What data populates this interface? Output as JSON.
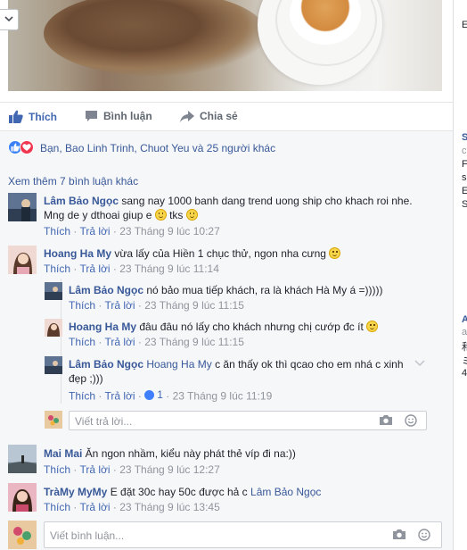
{
  "post": {
    "actions": {
      "like": "Thích",
      "comment": "Bình luận",
      "share": "Chia sẻ"
    },
    "reactions_text": "Bạn, Bao Linh Trinh, Chuot Yeu và 25 người khác",
    "more_comments": "Xem thêm 7 bình luận khác"
  },
  "labels": {
    "like": "Thích",
    "reply": "Trả lời"
  },
  "comments": [
    {
      "name": "Lâm Bảo Ngọc",
      "line1": " sang nay 1000 banh dang trend uong ship cho khach roi nhe.",
      "line2a": "Mng de y dthoai giup e ",
      "line2b": " tks ",
      "time": "23 Tháng 9 lúc 10:27"
    },
    {
      "name": "Hoang Ha My",
      "text": " vừa lấy của Hiền 1 chục thử, ngon nha cưng ",
      "time": "23 Tháng 9 lúc 11:14"
    },
    {
      "name": "Mai Mai",
      "text": " Ăn ngon nhầm, kiểu này phát thẻ víp đi na:))",
      "time": "23 Tháng 9 lúc 12:27"
    },
    {
      "name": "TràMy MyMy",
      "text": " E đặt 30c hay 50c được hả c ",
      "mention": "Lâm Bảo Ngọc",
      "time": "23 Tháng 9 lúc 13:45"
    }
  ],
  "replies": [
    {
      "name": "Lâm Bảo Ngọc",
      "text": " nó bảo mua tiếp khách, ra là khách Hà My á =)))))",
      "time": "23 Tháng 9 lúc 11:15"
    },
    {
      "name": "Hoang Ha My",
      "text": " đâu đâu nó lấy cho khách nhưng chị cướp đc ít ",
      "time": "23 Tháng 9 lúc 11:15"
    },
    {
      "name": "Lâm Bảo Ngọc",
      "mention": "Hoang Ha My",
      "line1": " c ăn thấy ok thì qcao cho em nhá c xinh",
      "line2": "đẹp ;)))",
      "likes": "1",
      "time": "23 Tháng 9 lúc 11:19"
    }
  ],
  "reply_input": {
    "placeholder": "Viết trả lời..."
  },
  "comment_input": {
    "placeholder": "Viết bình luận..."
  },
  "right_column": {
    "letters": [
      "E",
      "S",
      "c",
      "F",
      "s",
      "E",
      "S",
      "A",
      "a",
      "和",
      "ミ",
      "4"
    ]
  }
}
